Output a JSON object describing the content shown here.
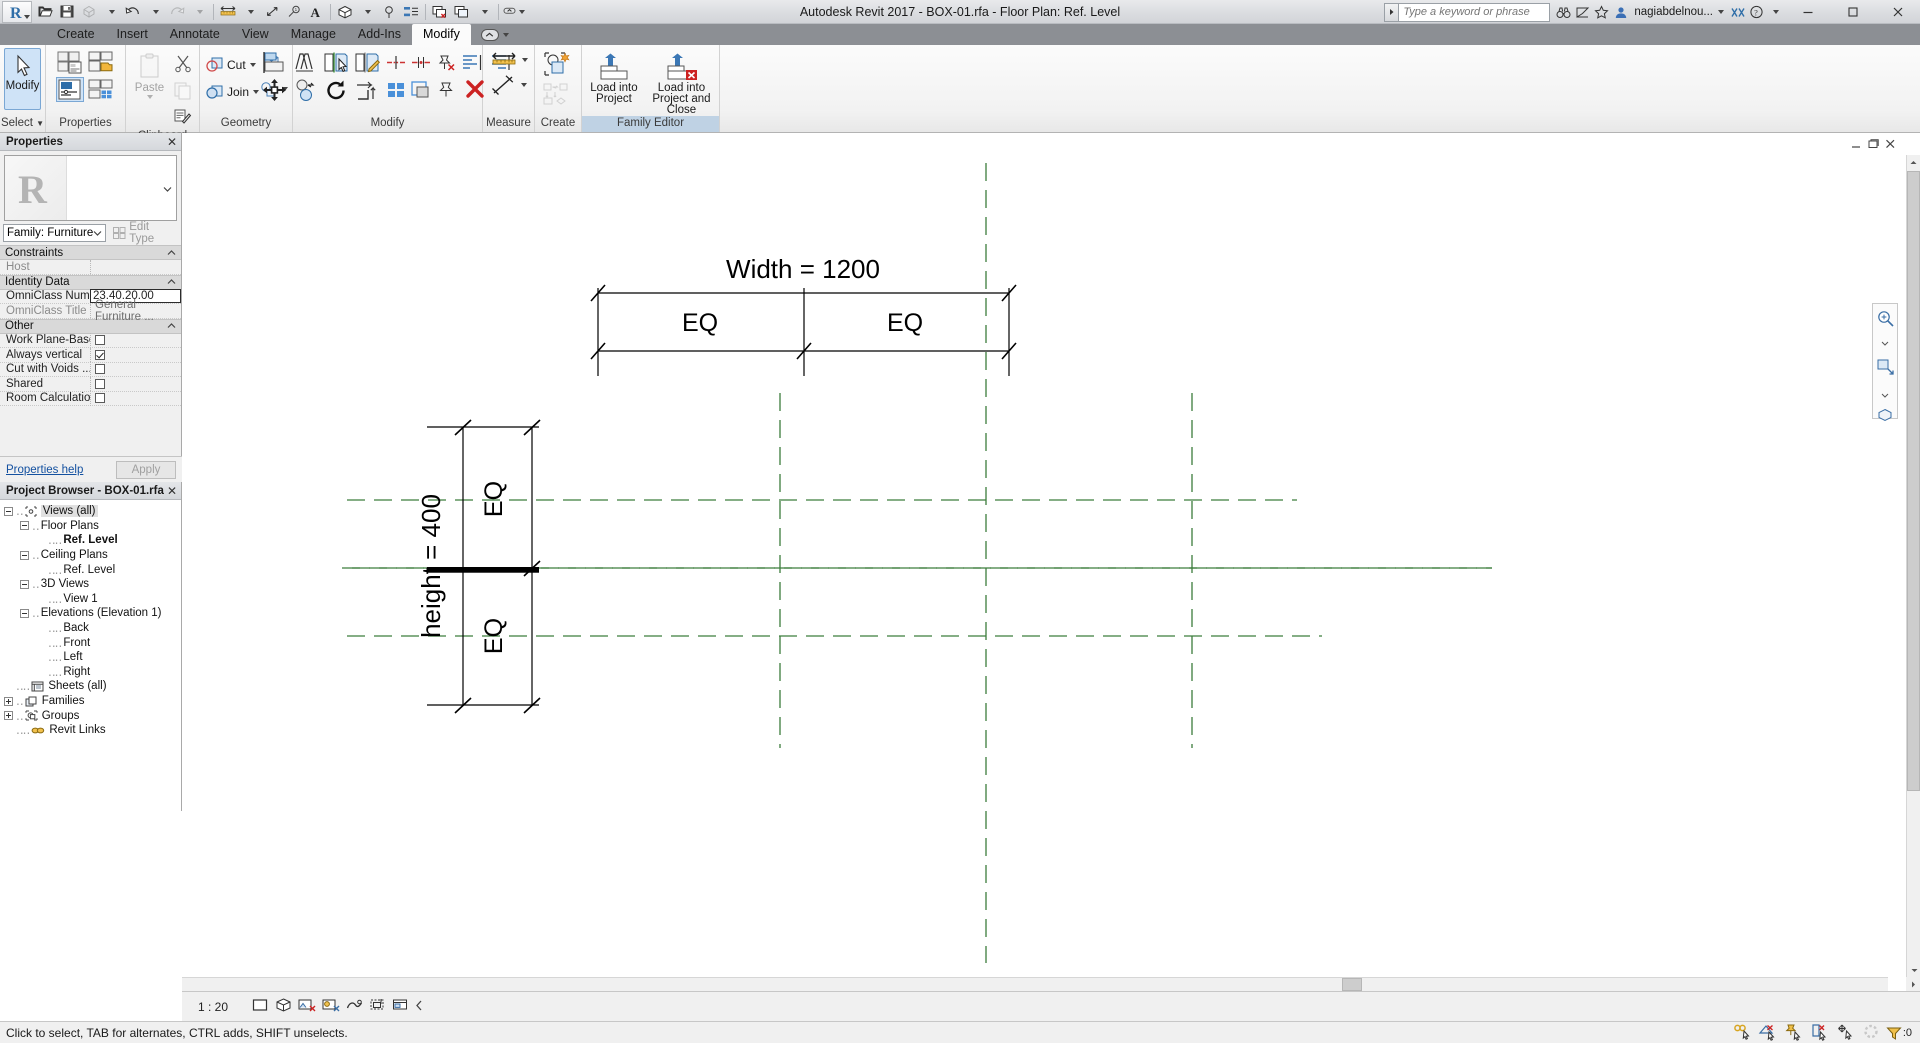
{
  "window": {
    "title": "Autodesk Revit 2017 -    BOX-01.rfa - Floor Plan: Ref. Level",
    "app_name": "Autodesk Revit 2017 -",
    "doc_name": "BOX-01.rfa - Floor Plan: Ref. Level",
    "minimize_label": "—",
    "maximize_label": "❐",
    "close_label": "✕"
  },
  "quick_access": {
    "items": [
      {
        "name": "revit-logo-icon",
        "label": "R"
      },
      {
        "name": "open-icon",
        "label": "Open"
      },
      {
        "name": "save-icon",
        "label": "Save"
      },
      {
        "name": "save-as-icon",
        "label": "Save As"
      },
      {
        "name": "undo-icon",
        "label": "Undo"
      },
      {
        "name": "redo-icon",
        "label": "Redo"
      },
      {
        "name": "measure-icon",
        "label": "Measure"
      },
      {
        "name": "aligned-dimension-icon",
        "label": "Aligned Dimension"
      },
      {
        "name": "tag-icon",
        "label": "Tag"
      },
      {
        "name": "text-icon",
        "label": "Text"
      },
      {
        "name": "default-3d-view-icon",
        "label": "Default 3D View"
      },
      {
        "name": "section-icon",
        "label": "Section"
      },
      {
        "name": "thin-lines-icon",
        "label": "Thin Lines"
      },
      {
        "name": "close-hidden-windows-icon",
        "label": "Close Hidden Windows"
      },
      {
        "name": "switch-windows-icon",
        "label": "Switch Windows"
      },
      {
        "name": "customize-qat-icon",
        "label": "Customize Quick Access Toolbar"
      }
    ]
  },
  "search": {
    "placeholder": "Type a keyword or phrase",
    "value": ""
  },
  "title_right": {
    "icons": [
      {
        "name": "search-binoculars-icon",
        "label": "Search"
      },
      {
        "name": "subscription-icon",
        "label": "Subscription"
      },
      {
        "name": "favorites-star-icon",
        "label": "Favorites"
      }
    ],
    "user": "nagiabdelnou...",
    "exchange_label": "Autodesk Exchange",
    "help_label": "?"
  },
  "ribbon": {
    "tabs": [
      {
        "label": "Create",
        "active": false
      },
      {
        "label": "Insert",
        "active": false
      },
      {
        "label": "Annotate",
        "active": false
      },
      {
        "label": "View",
        "active": false
      },
      {
        "label": "Manage",
        "active": false
      },
      {
        "label": "Add-Ins",
        "active": false
      },
      {
        "label": "Modify",
        "active": true
      }
    ],
    "panels": [
      {
        "title": "Select",
        "name": "panel-select"
      },
      {
        "title": "Properties",
        "name": "panel-properties"
      },
      {
        "title": "Clipboard",
        "name": "panel-clipboard"
      },
      {
        "title": "Geometry",
        "name": "panel-geometry"
      },
      {
        "title": "Modify",
        "name": "panel-modify"
      },
      {
        "title": "Measure",
        "name": "panel-measure"
      },
      {
        "title": "Create",
        "name": "panel-create"
      },
      {
        "title": "Family Editor",
        "name": "panel-family-editor"
      }
    ],
    "select": {
      "modify_label": "Modify",
      "dropdown_label": "Select"
    },
    "clipboard": {
      "paste_label": "Paste",
      "cut_label": "Cut",
      "copy_label": "Copy",
      "match_label": "Match Type Properties"
    },
    "geometry": {
      "cut_label": "Cut",
      "join_label": "Join"
    },
    "family_editor": {
      "load_into_project": "Load into\nProject",
      "load_into_project_l1": "Load into",
      "load_into_project_l2": "Project",
      "load_close_l1": "Load into",
      "load_close_l2": "Project and Close"
    }
  },
  "properties": {
    "header": "Properties",
    "close": "✕",
    "type_thumb_label": "R",
    "family_selector": "Family: Furniture",
    "edit_type_label": "Edit Type",
    "help_link": "Properties help",
    "apply_label": "Apply",
    "groups": [
      {
        "name": "Constraints",
        "rows": [
          {
            "key": "Host",
            "value": "",
            "type": "text",
            "dim_key": true
          }
        ]
      },
      {
        "name": "Identity Data",
        "rows": [
          {
            "key": "OmniClass Num...",
            "value": "23.40.20.00",
            "type": "edit",
            "dim_key": false
          },
          {
            "key": "OmniClass Title",
            "value": "General Furniture ...",
            "type": "text",
            "dim_key": true
          }
        ]
      },
      {
        "name": "Other",
        "rows": [
          {
            "key": "Work Plane-Based",
            "value": "",
            "type": "checkbox",
            "checked": false
          },
          {
            "key": "Always vertical",
            "value": "",
            "type": "checkbox",
            "checked": true
          },
          {
            "key": "Cut with Voids ...",
            "value": "",
            "type": "checkbox",
            "checked": false
          },
          {
            "key": "Shared",
            "value": "",
            "type": "checkbox",
            "checked": false
          },
          {
            "key": "Room Calculatio...",
            "value": "",
            "type": "checkbox",
            "checked": false
          }
        ]
      }
    ]
  },
  "project_browser": {
    "header": "Project Browser - BOX-01.rfa",
    "close": "✕",
    "nodes": [
      {
        "label": "Views (all)",
        "indent": 0,
        "toggle": "minus",
        "icon": "views-icon",
        "selected": true,
        "bold": false
      },
      {
        "label": "Floor Plans",
        "indent": 1,
        "toggle": "minus",
        "icon": "",
        "selected": false,
        "bold": false
      },
      {
        "label": "Ref. Level",
        "indent": 2,
        "toggle": "none",
        "icon": "",
        "selected": false,
        "bold": true
      },
      {
        "label": "Ceiling Plans",
        "indent": 1,
        "toggle": "minus",
        "icon": "",
        "selected": false,
        "bold": false
      },
      {
        "label": "Ref. Level",
        "indent": 2,
        "toggle": "none",
        "icon": "",
        "selected": false,
        "bold": false
      },
      {
        "label": "3D Views",
        "indent": 1,
        "toggle": "minus",
        "icon": "",
        "selected": false,
        "bold": false
      },
      {
        "label": "View 1",
        "indent": 2,
        "toggle": "none",
        "icon": "",
        "selected": false,
        "bold": false
      },
      {
        "label": "Elevations (Elevation 1)",
        "indent": 1,
        "toggle": "minus",
        "icon": "",
        "selected": false,
        "bold": false
      },
      {
        "label": "Back",
        "indent": 2,
        "toggle": "none",
        "icon": "",
        "selected": false,
        "bold": false
      },
      {
        "label": "Front",
        "indent": 2,
        "toggle": "none",
        "icon": "",
        "selected": false,
        "bold": false
      },
      {
        "label": "Left",
        "indent": 2,
        "toggle": "none",
        "icon": "",
        "selected": false,
        "bold": false
      },
      {
        "label": "Right",
        "indent": 2,
        "toggle": "none",
        "icon": "",
        "selected": false,
        "bold": false
      },
      {
        "label": "Sheets (all)",
        "indent": 0,
        "toggle": "none",
        "icon": "sheets-icon",
        "selected": false,
        "bold": false
      },
      {
        "label": "Families",
        "indent": 0,
        "toggle": "plus",
        "icon": "families-icon",
        "selected": false,
        "bold": false
      },
      {
        "label": "Groups",
        "indent": 0,
        "toggle": "plus",
        "icon": "groups-icon",
        "selected": false,
        "bold": false
      },
      {
        "label": "Revit Links",
        "indent": 0,
        "toggle": "none",
        "icon": "revit-links-icon",
        "selected": false,
        "bold": false
      }
    ]
  },
  "drawing": {
    "width_dimension": "Width = 1200",
    "height_dimension": "height = 400",
    "eq_top_left": "EQ",
    "eq_top_right": "EQ",
    "eq_left_top": "EQ",
    "eq_left_bottom": "EQ",
    "colors": {
      "reference_plane_green": "#3c7d3c",
      "geometry_black": "#000000",
      "canvas_background": "#ffffff"
    }
  },
  "view_controls": {
    "scale": "1 : 20",
    "icons": [
      {
        "name": "detail-level-icon",
        "label": "Detail Level"
      },
      {
        "name": "visual-style-icon",
        "label": "Visual Style"
      },
      {
        "name": "sun-path-icon",
        "label": "Sun Path"
      },
      {
        "name": "shadows-icon",
        "label": "Shadows"
      },
      {
        "name": "render-dialog-icon",
        "label": "Show Rendering Dialog"
      },
      {
        "name": "crop-view-icon",
        "label": "Crop View"
      },
      {
        "name": "crop-region-icon",
        "label": "Show Crop Region"
      },
      {
        "name": "more-chevron-icon",
        "label": "More"
      }
    ]
  },
  "status_bar": {
    "message": "Click to select, TAB for alternates, CTRL adds, SHIFT unselects.",
    "filter_count": ":0",
    "icons": [
      {
        "name": "editable-only-icon",
        "label": "Editable Only"
      },
      {
        "name": "exclude-options-icon",
        "label": "Exclude Options"
      },
      {
        "name": "select-pinned-icon",
        "label": "Select Pinned Elements"
      },
      {
        "name": "select-links-icon",
        "label": "Select Links"
      },
      {
        "name": "select-underlay-icon",
        "label": "Select Elements by Face"
      },
      {
        "name": "drag-elements-icon",
        "label": "Drag Elements on Selection"
      },
      {
        "name": "filter-icon",
        "label": "Filter"
      }
    ]
  },
  "view_window_buttons": {
    "minimize": "—",
    "restore": "❐",
    "close": "✕",
    "expand": "⌃"
  }
}
